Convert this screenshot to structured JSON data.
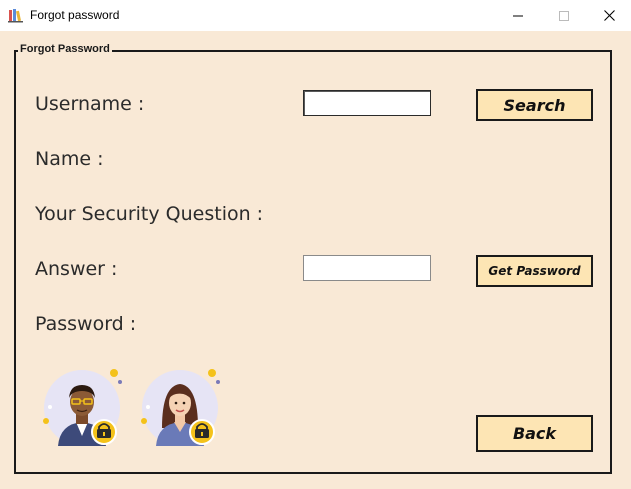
{
  "window": {
    "title": "Forgot password",
    "icon": "books-app-icon",
    "controls": [
      "minimize-icon",
      "maximize-icon",
      "close-icon"
    ]
  },
  "group": {
    "legend": "Forgot Password"
  },
  "labels": {
    "username": "Username :",
    "name": "Name :",
    "security_question": "Your Security Question :",
    "answer": "Answer :",
    "password": "Password :"
  },
  "inputs": {
    "username": {
      "value": "",
      "placeholder": ""
    },
    "answer": {
      "value": "",
      "placeholder": ""
    }
  },
  "buttons": {
    "search": "Search",
    "get_password": "Get Password",
    "back": "Back"
  },
  "colors": {
    "background": "#f9e9d6",
    "button_fill": "#fde5b4",
    "border": "#1a1a1a"
  },
  "illustrations": [
    "man-with-lock-avatar",
    "woman-with-lock-avatar"
  ]
}
